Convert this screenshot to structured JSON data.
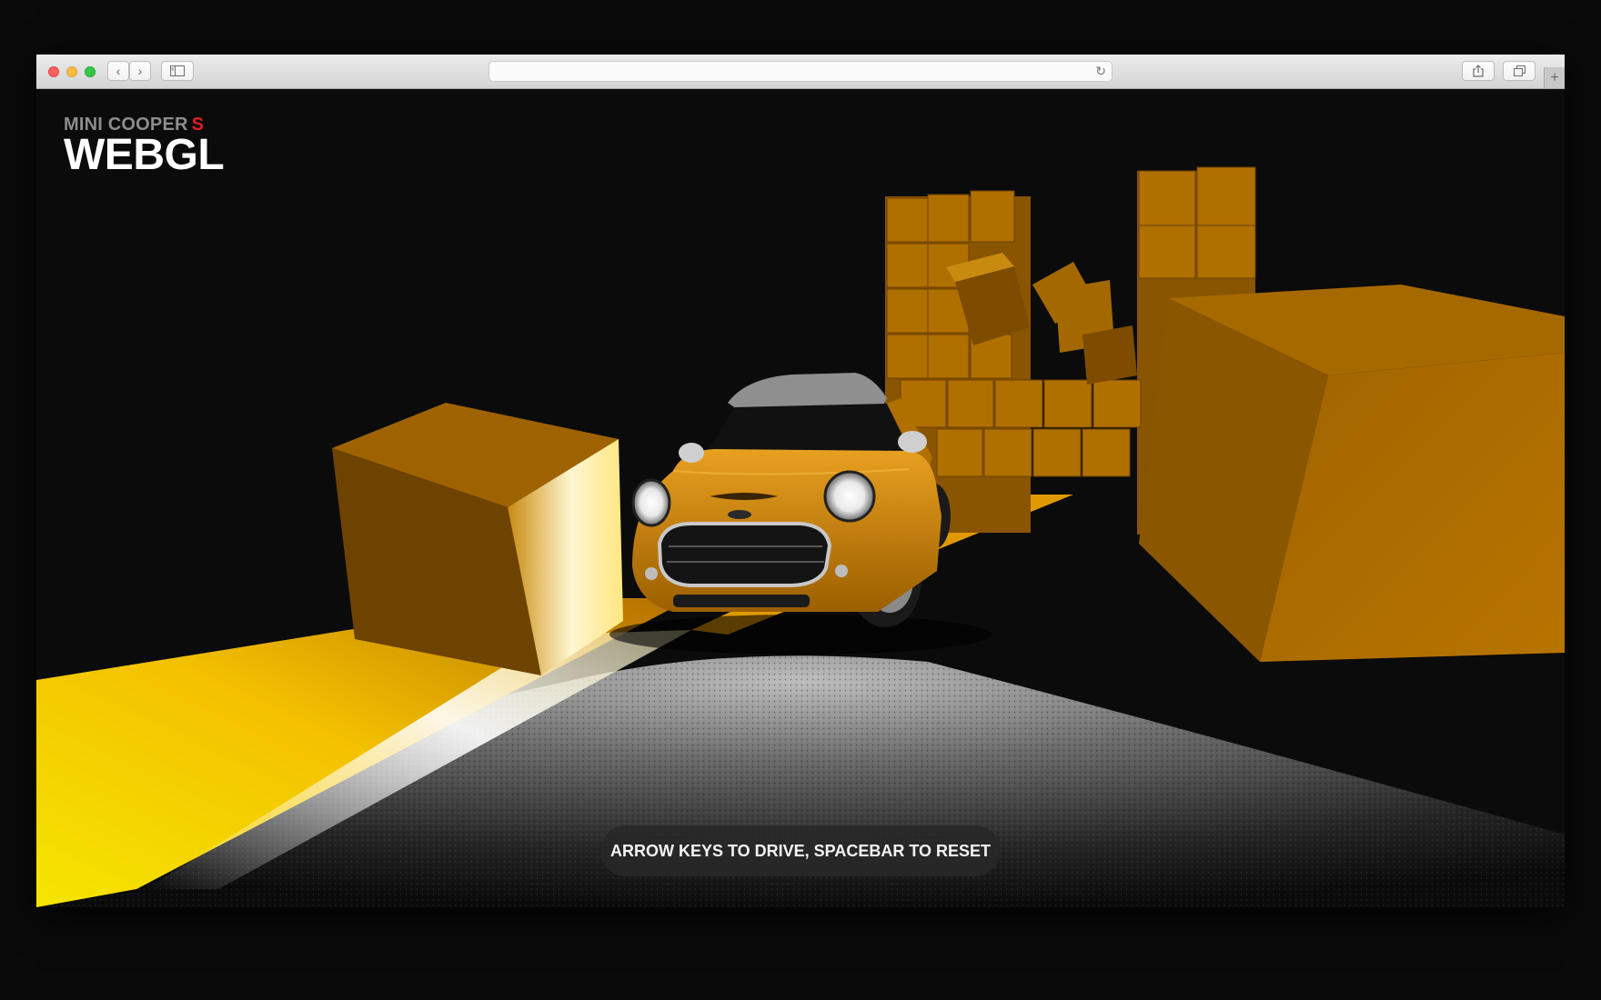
{
  "browser": {
    "url": "",
    "icons": {
      "back": "chevron-left-icon",
      "forward": "chevron-right-icon",
      "sidebar": "sidebar-icon",
      "reload": "reload-icon",
      "share": "share-icon",
      "tabs": "tabs-overview-icon",
      "new_tab": "plus-icon"
    }
  },
  "page": {
    "brand_line": "MINI COOPER",
    "brand_accent": "S",
    "brand_title": "WEBGL",
    "hint": "ARROW KEYS TO DRIVE, SPACEBAR TO RESET"
  },
  "colors": {
    "accent_red": "#e01e1e",
    "box_orange": "#b8780a",
    "car_orange": "#d68f0c",
    "light_yellow": "#ffe600",
    "background": "#0b0b0b"
  }
}
